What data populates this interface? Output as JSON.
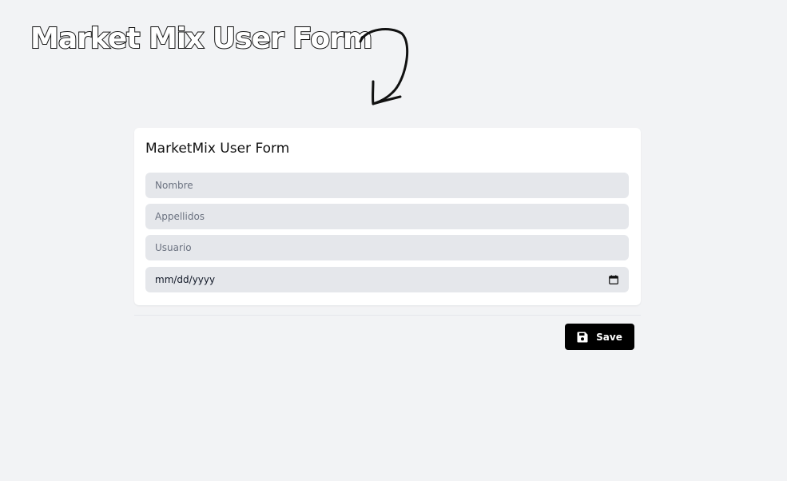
{
  "hero": {
    "title": "Market Mix User Form"
  },
  "form": {
    "title": "MarketMix User Form",
    "fields": {
      "nombre": {
        "placeholder": "Nombre",
        "value": ""
      },
      "apellidos": {
        "placeholder": "Appellidos",
        "value": ""
      },
      "usuario": {
        "placeholder": "Usuario",
        "value": ""
      },
      "fecha": {
        "value": "mm/dd/yyyy",
        "icon": "calendar-icon"
      }
    }
  },
  "actions": {
    "save_label": "Save",
    "save_icon": "floppy-disk-icon"
  },
  "colors": {
    "background": "#f2f3f5",
    "card": "#ffffff",
    "input": "#e5e7eb",
    "button": "#000000",
    "button_text": "#ffffff"
  }
}
